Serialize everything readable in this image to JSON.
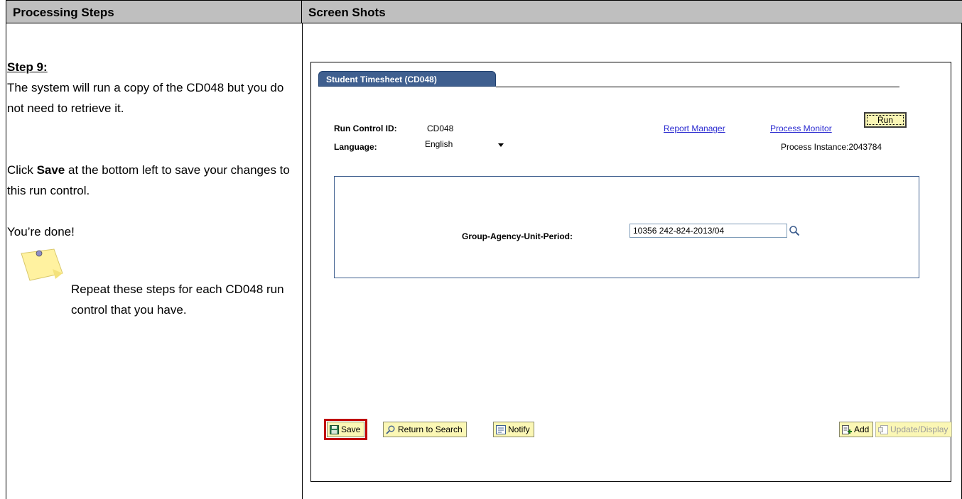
{
  "table": {
    "col_left_header": "Processing Steps",
    "col_right_header": "Screen Shots"
  },
  "steps": {
    "title": "Step 9:",
    "line1": "The system will run a copy of the CD048 but you do not need to retrieve it.",
    "click_pre": "Click ",
    "click_bold": "Save",
    "click_post": " at the bottom left to save your changes to this run control.",
    "done": "You’re done!",
    "note": "Repeat these steps for each CD048 run control that you have.",
    "note_icon": "sticky-note-icon"
  },
  "screen": {
    "tab_label": "Student Timesheet (CD048)",
    "run_control_label": "Run Control ID:",
    "run_control_value": "CD048",
    "language_label": "Language:",
    "language_value": "English",
    "report_manager": "Report Manager",
    "process_monitor": "Process Monitor",
    "run_label": "Run",
    "process_instance": "Process Instance:2043784",
    "gaup_label": "Group-Agency-Unit-Period:",
    "gaup_value": "10356 242-824-2013/04",
    "buttons": {
      "save": "Save",
      "return_to_search": "Return to Search",
      "notify": "Notify",
      "add": "Add",
      "update_display": "Update/Display"
    },
    "accent": "#3f5f8f",
    "button_bg": "#fbf7b5",
    "highlight": "#c00000"
  }
}
